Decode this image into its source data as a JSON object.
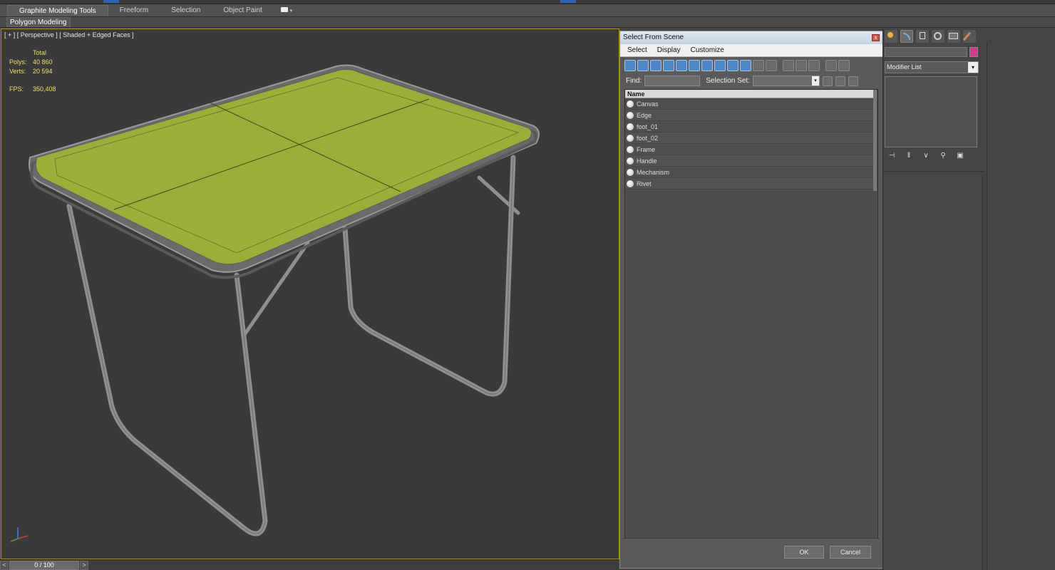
{
  "ribbon": {
    "tabs": [
      {
        "label": "Graphite Modeling Tools",
        "active": true
      },
      {
        "label": "Freeform",
        "active": false
      },
      {
        "label": "Selection",
        "active": false
      },
      {
        "label": "Object Paint",
        "active": false
      }
    ],
    "subtab": "Polygon Modeling"
  },
  "viewport": {
    "label": "[ + ] [ Perspective ] [ Shaded + Edged Faces ]",
    "stats": {
      "header": "Total",
      "polys_label": "Polys:",
      "polys_value": "40 860",
      "verts_label": "Verts:",
      "verts_value": "20 594",
      "fps_label": "FPS:",
      "fps_value": "350,408"
    },
    "tabletop_color": "#9aae3a",
    "frame_color": "#8a8a8a"
  },
  "timeline": {
    "frame": "0 / 100",
    "prev": "<",
    "next": ">"
  },
  "dialog": {
    "title": "Select From Scene",
    "close": "x",
    "menu": [
      "Select",
      "Display",
      "Customize"
    ],
    "find_label": "Find:",
    "selset_label": "Selection Set:",
    "column_header": "Name",
    "items": [
      "Canvas",
      "Edge",
      "foot_01",
      "foot_02",
      "Frame",
      "Handle",
      "Mechanism",
      "Rivet"
    ],
    "ok": "OK",
    "cancel": "Cancel"
  },
  "command_panel": {
    "modifier_list": "Modifier List",
    "object_color": "#d03a8c"
  }
}
